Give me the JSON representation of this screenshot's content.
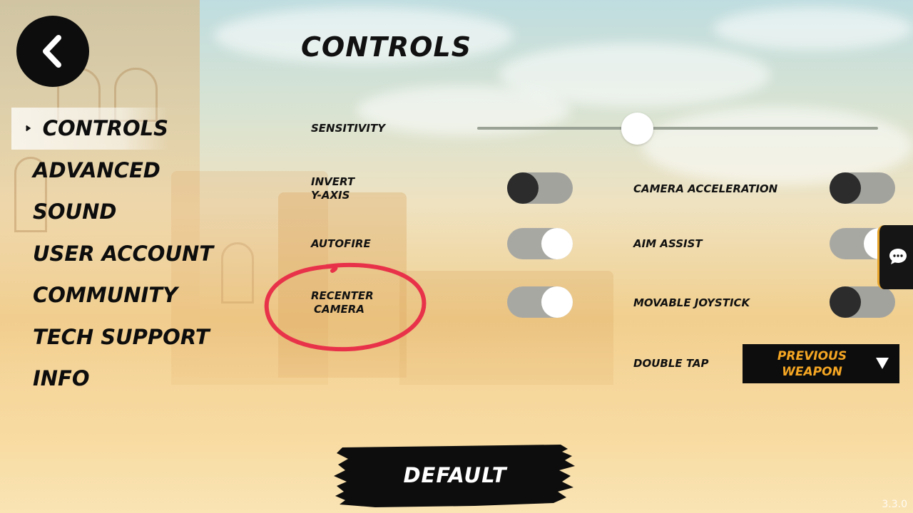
{
  "header": {
    "title": "CONTROLS",
    "back_icon": "chevron-left-icon"
  },
  "sidebar": {
    "items": [
      {
        "label": "CONTROLS",
        "active": true
      },
      {
        "label": "ADVANCED",
        "active": false
      },
      {
        "label": "SOUND",
        "active": false
      },
      {
        "label": "USER ACCOUNT",
        "active": false
      },
      {
        "label": "COMMUNITY",
        "active": false
      },
      {
        "label": "TECH SUPPORT",
        "active": false
      },
      {
        "label": "INFO",
        "active": false
      }
    ]
  },
  "settings": {
    "sensitivity": {
      "label": "SENSITIVITY",
      "value": 0.4
    },
    "invert_y_axis": {
      "label_line1": "INVERT",
      "label_line2": "Y-AXIS",
      "on": false
    },
    "autofire": {
      "label": "AUTOFIRE",
      "on": true
    },
    "recenter_camera": {
      "label_line1": "RECENTER",
      "label_line2": "CAMERA",
      "on": true,
      "annotated": true
    },
    "camera_acceleration": {
      "label": "CAMERA ACCELERATION",
      "on": false
    },
    "aim_assist": {
      "label": "AIM ASSIST",
      "on": true
    },
    "movable_joystick": {
      "label": "MOVABLE JOYSTICK",
      "on": false
    },
    "double_tap": {
      "label": "DOUBLE TAP",
      "value_line1": "PREVIOUS",
      "value_line2": "WEAPON"
    }
  },
  "footer": {
    "default_label": "DEFAULT",
    "version": "3.3.0"
  },
  "chat": {
    "icon": "chat-bubble-icon"
  },
  "colors": {
    "accent": "#f5a623",
    "annotation": "#e8324a",
    "dark": "#0d0d0d"
  }
}
